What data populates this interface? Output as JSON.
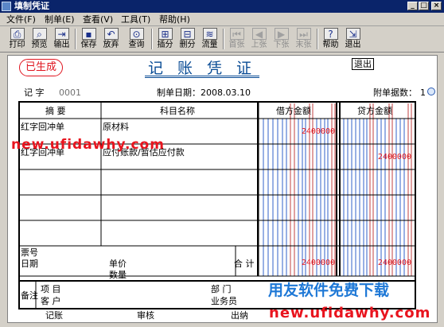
{
  "window": {
    "title": "填制凭证",
    "min_glyph": "_",
    "max_glyph": "□",
    "close_glyph": "×"
  },
  "menu": [
    {
      "label": "文件(F)"
    },
    {
      "label": "制单(E)"
    },
    {
      "label": "查看(V)"
    },
    {
      "label": "工具(T)"
    },
    {
      "label": "帮助(H)"
    }
  ],
  "toolbar": [
    {
      "label": "打印",
      "icon": "printer-icon",
      "glyph": "⎙",
      "enabled": true
    },
    {
      "label": "预览",
      "icon": "preview-icon",
      "glyph": "⌕",
      "enabled": true
    },
    {
      "label": "输出",
      "icon": "export-icon",
      "glyph": "⇥",
      "enabled": true
    },
    {
      "label": "保存",
      "icon": "save-icon",
      "glyph": "▪",
      "enabled": true
    },
    {
      "label": "放弃",
      "icon": "undo-icon",
      "glyph": "↶",
      "enabled": true
    },
    {
      "label": "查询",
      "icon": "binoculars-icon",
      "glyph": "⊙",
      "enabled": true
    },
    {
      "label": "插分",
      "icon": "insert-row-icon",
      "glyph": "⊞",
      "enabled": true
    },
    {
      "label": "删分",
      "icon": "delete-row-icon",
      "glyph": "⊟",
      "enabled": true
    },
    {
      "label": "流量",
      "icon": "cash-flow-icon",
      "glyph": "≋",
      "enabled": true
    },
    {
      "label": "首张",
      "icon": "first-icon",
      "glyph": "⏮",
      "enabled": false
    },
    {
      "label": "上张",
      "icon": "prev-icon",
      "glyph": "◀",
      "enabled": false
    },
    {
      "label": "下张",
      "icon": "next-icon",
      "glyph": "▶",
      "enabled": false
    },
    {
      "label": "末张",
      "icon": "last-icon",
      "glyph": "⏭",
      "enabled": false
    },
    {
      "label": "帮助",
      "icon": "help-icon",
      "glyph": "?",
      "enabled": true
    },
    {
      "label": "退出",
      "icon": "exit-icon",
      "glyph": "⇲",
      "enabled": true
    }
  ],
  "voucher": {
    "stamp": "已生成",
    "title": "记 账 凭 证",
    "exit_box": "退出",
    "type_label": "记 字",
    "number": "0001",
    "date_label": "制单日期：2008.03.10",
    "attachments_label": "附单据数：",
    "attachments_value": "1"
  },
  "grid": {
    "col_summary": "摘 要",
    "col_account": "科目名称",
    "col_debit": "借方金额",
    "col_credit": "贷方金额",
    "rows": [
      {
        "summary": "红字回冲单",
        "account": "原材料",
        "debit": "2400000",
        "credit": ""
      },
      {
        "summary": "红字回冲单",
        "account": "应付账款/暂估应付款",
        "debit": "",
        "credit": "2400000"
      }
    ],
    "ticket_label": "票号",
    "date_label": "日期",
    "price_label": "单价",
    "qty_label": "数量",
    "total_label": "合 计",
    "total_debit": "2400000",
    "total_credit": "2400000"
  },
  "bottom": {
    "note_label": "备注",
    "project_label": "项 目",
    "customer_label": "客 户",
    "department_label": "部 门",
    "clerk_label": "业务员"
  },
  "signatures": {
    "bookkeeper": "记账",
    "auditor": "审核",
    "cashier": "出纳"
  },
  "watermark": {
    "url_top": "new.ufidawhy.com",
    "slogan": "用友软件免费下载",
    "url_bottom": "new.ufidawhy.com"
  },
  "colors": {
    "title_blue": "#0a4c95",
    "stamp_red": "#e0141e",
    "watermark_red": "#e8141e",
    "slogan_blue": "#1e78d6"
  }
}
